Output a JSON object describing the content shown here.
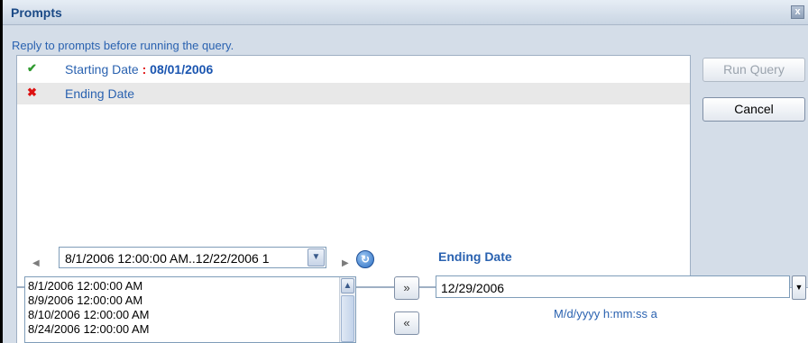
{
  "dialog": {
    "title": "Prompts",
    "close_glyph": "x",
    "instruction": "Reply to prompts before running the query."
  },
  "prompts": [
    {
      "status": "answered",
      "status_glyph": "✔",
      "label": "Starting Date",
      "separator": ":",
      "value": "08/01/2006"
    },
    {
      "status": "unanswered",
      "status_glyph": "✖",
      "label": "Ending Date",
      "separator": "",
      "value": ""
    }
  ],
  "buttons": {
    "run_query": "Run Query",
    "cancel": "Cancel",
    "add": "»",
    "remove": "«"
  },
  "value_picker": {
    "range_selected": "8/1/2006 12:00:00 AM..12/22/2006 1",
    "values": [
      "8/1/2006 12:00:00 AM",
      "8/9/2006 12:00:00 AM",
      "8/10/2006 12:00:00 AM",
      "8/24/2006 12:00:00 AM"
    ]
  },
  "editor": {
    "heading": "Ending Date",
    "value": "12/29/2006",
    "format_hint": "M/d/yyyy h:mm:ss a"
  },
  "icons": {
    "answered": "check-icon",
    "unanswered": "cross-icon",
    "refresh": "refresh-icon",
    "prev": "arrow-left-icon",
    "next": "arrow-right-icon"
  },
  "colors": {
    "accent": "#2a62b0",
    "answered": "#2f9a2f",
    "unanswered": "#dd1111",
    "value": "#1a55b0"
  }
}
